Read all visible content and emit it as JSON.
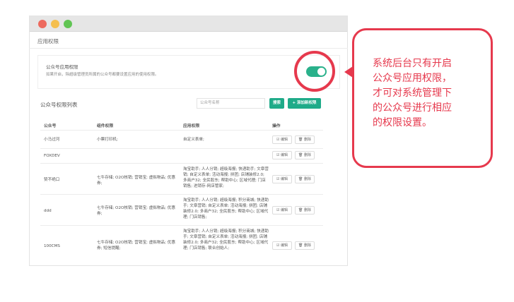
{
  "window": {
    "dot_colors": [
      "#ed6a5e",
      "#f5bf4f",
      "#61c554"
    ]
  },
  "section": {
    "title": "应用权限"
  },
  "card": {
    "title": "公众号应用权限",
    "description": "如果开启，除超级管理员所属的公众号都要设置应用的使用权限。",
    "toggle_on": true
  },
  "list": {
    "title": "公众号权限列表",
    "search_placeholder": "公众号名称",
    "search_button": "搜索",
    "add_button": "+ 添加新权限"
  },
  "table": {
    "headers": [
      "公众号",
      "组件权限",
      "应用权限",
      "操作"
    ],
    "edit_label": "☑ 编辑",
    "delete_label": "🗑 删除",
    "rows": [
      {
        "account": "小马过河",
        "components": "小票打印机;",
        "apps": "自定义表单;"
      },
      {
        "account": "FOXDEV",
        "components": "",
        "apps": ""
      },
      {
        "account": "赞不绝口",
        "components": "七牛存储; O2O核销; 营销宝; 虚拟物品; 优惠券;",
        "apps": "淘宝助手; 人人分销; 超级海报; 快递助手; 文章营销; 自定义表单; 活动海报; 拼团; 店铺装修2.0; 多商户32; 全民股东; 帮助中心; 区域代理; 门店销售; 进销存-网店管家;"
      },
      {
        "account": "ddd",
        "components": "七牛存储; O2O核销; 营销宝; 虚拟物品; 优惠券;",
        "apps": "淘宝助手; 人人分销; 超级海报; 积分商城; 快递助手; 文章营销; 自定义表单; 活动海报; 拼团; 店铺装修2.0; 多商户32; 全民股东; 帮助中心; 区域代理; 门店销售;"
      },
      {
        "account": "100CMS",
        "components": "七牛存储; O2O核销; 营销宝; 虚拟物品; 优惠券; 短信提醒;",
        "apps": "淘宝助手; 人人分销; 超级海报; 积分商城; 快递助手; 文章营销; 自定义表单; 活动海报; 拼团; 店铺装修2.0; 多商户32; 全民股东; 帮助中心; 区域代理; 门店销售; 联合创始人;"
      }
    ]
  },
  "callout": {
    "lines": [
      "系统后台只有开启",
      "公众号应用权限，",
      "才可对系统管理下",
      "的公众号进行相应",
      "的权限设置。"
    ],
    "color": "#e6394d"
  },
  "accent": "#1fab89"
}
